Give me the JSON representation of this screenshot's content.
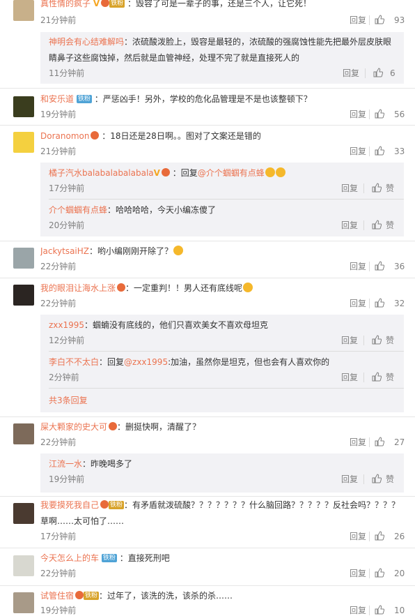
{
  "ui": {
    "reply_label": "回复",
    "like_label": "赞"
  },
  "comments": [
    {
      "user": "真性情的疯子",
      "text": "：毁容了可是一辈子的事，还是三个人，让它死！",
      "time": "21分钟前",
      "likes": "93",
      "badge": "铁粉"
    },
    {
      "user": "神明会有心结难解吗",
      "text": "：浓硫酸泼脸上，毁容是最轻的，浓硫酸的强腐蚀性能先把最外层皮肤眼",
      "text2": "睛鼻子这些腐蚀掉，然后就是血管神经，处理不完了就是直接死人的",
      "time": "11分钟前",
      "likes": "6"
    },
    {
      "user": "和安乐道",
      "text": "：严惩凶手！另外，学校的危化品管理是不是也该整顿下？",
      "time": "19分钟前",
      "likes": "56",
      "badge": "铁粉"
    },
    {
      "user": "Doranomon",
      "text": "：18日还是28日啊。。图对了文案还是错的",
      "time": "21分钟前",
      "likes": "33"
    },
    {
      "user": "橘子汽水balabalabalabala",
      "text": "：回复",
      "mention": "@介个蝈蝈有点蜂",
      "time": "17分钟前"
    },
    {
      "user": "介个蝈蝈有点蜂",
      "text": "：哈哈哈哈，今天小编冻傻了",
      "time": "20分钟前"
    },
    {
      "user": "JackytsaiHZ",
      "text": "：哟小编刚刚开除了？",
      "time": "22分钟前",
      "likes": "36"
    },
    {
      "user": "我的眼泪让海水上涨",
      "text": "：一定重判！！男人还有底线呢",
      "time": "22分钟前",
      "likes": "32"
    },
    {
      "user": "zxx1995",
      "text": "：蝈蝻没有底线的，他们只喜欢美女不喜欢母坦克",
      "time": "12分钟前"
    },
    {
      "user": "李白不不太白",
      "text": "：回复",
      "mention": "@zxx1995",
      "text_after": ":加油，虽然你是坦克，但也会有人喜欢你的",
      "time": "2分钟前"
    },
    {
      "more": "共3条回复"
    },
    {
      "user": "屎大颗家的史大可",
      "text": "：删挺快啊，清醒了？",
      "time": "22分钟前",
      "likes": "27"
    },
    {
      "user": "江流一水",
      "text": "：昨晚喝多了",
      "time": "19分钟前"
    },
    {
      "user": "我要摸死我自己",
      "text": "：有矛盾就泼硫酸？？？？？？？什么脑回路？？？？？反社会吗？？？？",
      "text2": "草啊……太可怕了……",
      "time": "17分钟前",
      "likes": "26",
      "badge": "铁粉"
    },
    {
      "user": "今天怎么上的车",
      "text": "：直接死刑吧",
      "time": "22分钟前",
      "likes": "20",
      "badge": "铁粉"
    },
    {
      "user": "试管住宿",
      "text": "：过年了，该洗的洗，该杀的杀……",
      "time": "19分钟前",
      "likes": "10",
      "badge": "铁粉"
    }
  ]
}
